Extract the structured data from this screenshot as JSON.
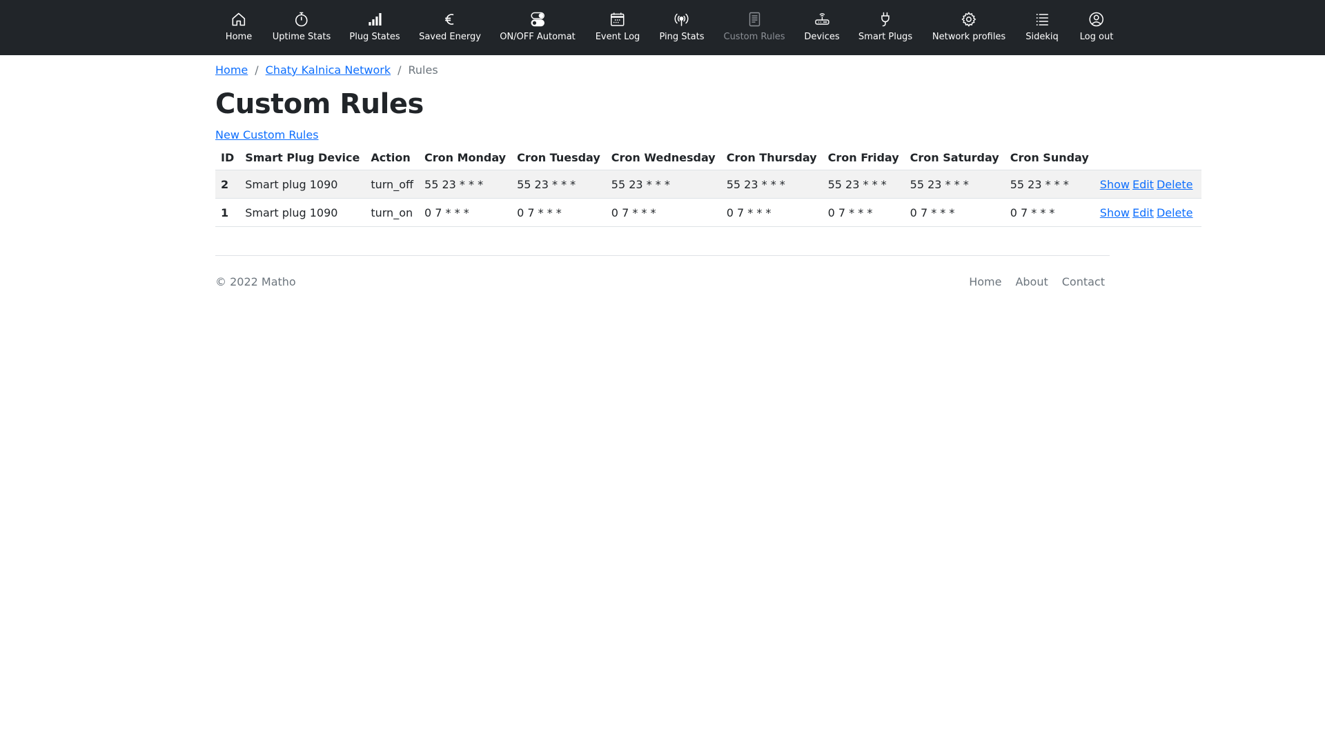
{
  "nav": {
    "items": [
      {
        "label": "Home",
        "icon": "home-icon"
      },
      {
        "label": "Uptime Stats",
        "icon": "stopwatch-icon"
      },
      {
        "label": "Plug States",
        "icon": "signal-bars-icon"
      },
      {
        "label": "Saved Energy",
        "icon": "euro-icon"
      },
      {
        "label": "ON/OFF Automat",
        "icon": "toggles-icon"
      },
      {
        "label": "Event Log",
        "icon": "calendar-icon"
      },
      {
        "label": "Ping Stats",
        "icon": "broadcast-icon"
      },
      {
        "label": "Custom Rules",
        "icon": "file-text-icon",
        "disabled": true
      },
      {
        "label": "Devices",
        "icon": "router-icon"
      },
      {
        "label": "Smart Plugs",
        "icon": "plug-icon"
      },
      {
        "label": "Network profiles",
        "icon": "gear-icon"
      },
      {
        "label": "Sidekiq",
        "icon": "list-icon"
      },
      {
        "label": "Log out",
        "icon": "person-circle-icon"
      }
    ]
  },
  "breadcrumb": {
    "home": "Home",
    "network": "Chaty Kalnica Network",
    "separator": "/",
    "current": "Rules"
  },
  "page": {
    "title": "Custom Rules",
    "new_link": "New Custom Rules"
  },
  "table": {
    "headers": [
      "ID",
      "Smart Plug Device",
      "Action",
      "Cron Monday",
      "Cron Tuesday",
      "Cron Wednesday",
      "Cron Thursday",
      "Cron Friday",
      "Cron Saturday",
      "Cron Sunday"
    ],
    "rows": [
      {
        "id": "2",
        "device": "Smart plug 1090",
        "action": "turn_off",
        "mon": "55 23 * * *",
        "tue": "55 23 * * *",
        "wed": "55 23 * * *",
        "thu": "55 23 * * *",
        "fri": "55 23 * * *",
        "sat": "55 23 * * *",
        "sun": "55 23 * * *"
      },
      {
        "id": "1",
        "device": "Smart plug 1090",
        "action": "turn_on",
        "mon": "0 7 * * *",
        "tue": "0 7 * * *",
        "wed": "0 7 * * *",
        "thu": "0 7 * * *",
        "fri": "0 7 * * *",
        "sat": "0 7 * * *",
        "sun": "0 7 * * *"
      }
    ],
    "show_label": "Show",
    "edit_label": "Edit",
    "delete_label": "Delete"
  },
  "footer": {
    "copyright": "© 2022 Matho",
    "links": [
      "Home",
      "About",
      "Contact"
    ]
  },
  "colors": {
    "navbar_bg": "#212529",
    "link": "#0d6efd",
    "muted": "#6c757d",
    "stripe": "#f2f2f2"
  }
}
